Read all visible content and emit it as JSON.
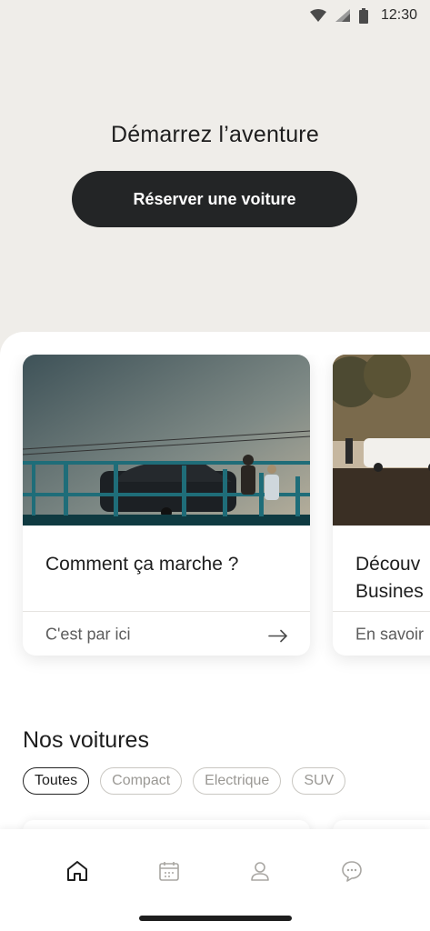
{
  "status_bar": {
    "time": "12:30",
    "icons": [
      "wifi-icon",
      "signal-icon",
      "battery-icon"
    ]
  },
  "hero": {
    "title": "Démarrez l’aventure",
    "cta_label": "Réserver une voiture"
  },
  "cards": [
    {
      "title": "Comment ça marche ?",
      "link": "C'est par ici",
      "image": "car-on-bridge-photo"
    },
    {
      "title": "Découv\nBusines",
      "link": "En savoir",
      "image": "street-with-van-photo"
    }
  ],
  "cars_section": {
    "title": "Nos voitures",
    "filters": [
      {
        "label": "Toutes",
        "active": true
      },
      {
        "label": "Compact",
        "active": false
      },
      {
        "label": "Electrique",
        "active": false
      },
      {
        "label": "SUV",
        "active": false
      }
    ]
  },
  "bottom_nav": {
    "items": [
      "home-icon",
      "calendar-icon",
      "profile-icon",
      "chat-icon"
    ],
    "active": "home-icon"
  },
  "colors": {
    "background": "#efede9",
    "button": "#232526",
    "teal_railing": "#1f6d79"
  }
}
